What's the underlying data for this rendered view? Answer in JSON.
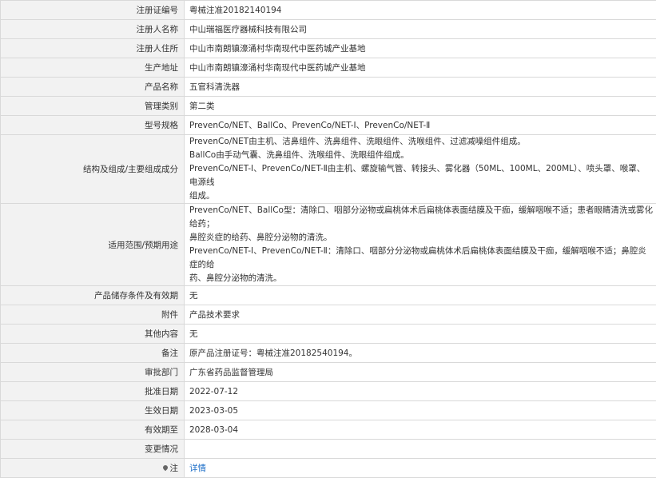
{
  "rows": [
    {
      "label": "注册证编号",
      "value": "粤械注准20182140194"
    },
    {
      "label": "注册人名称",
      "value": "中山瑞福医疗器械科技有限公司"
    },
    {
      "label": "注册人住所",
      "value": "中山市南朗镇濠涌村华南现代中医药城产业基地"
    },
    {
      "label": "生产地址",
      "value": "中山市南朗镇濠涌村华南现代中医药城产业基地"
    },
    {
      "label": "产品名称",
      "value": "五官科清洗器"
    },
    {
      "label": "管理类别",
      "value": "第二类"
    },
    {
      "label": "型号规格",
      "value": "PrevenCo/NET、BallCo、PrevenCo/NET-Ⅰ、PrevenCo/NET-Ⅱ"
    }
  ],
  "structure": {
    "label": "结构及组成/主要组成成分",
    "lines": [
      "PrevenCo/NET由主机、洁鼻组件、洗鼻组件、洗眼组件、洗喉组件、过滤减噪组件组成。",
      "BallCo由手动气囊、洗鼻组件、洗喉组件、洗眼组件组成。",
      "PrevenCo/NET-Ⅰ、PrevenCo/NET-Ⅱ由主机、螺旋输气管、转接头、雾化器（50ML、100ML、200ML）、喷头罩、喉罩、电源线",
      "组成。"
    ]
  },
  "usage": {
    "label": "适用范围/预期用途",
    "lines": [
      "PrevenCo/NET、BallCo型：清除口、咽部分泌物或扁桃体术后扁桃体表面结膜及干痂，缓解咽喉不适；患者眼睛清洗或雾化给药；",
      "鼻腔炎症的给药、鼻腔分泌物的清洗。",
      "PrevenCo/NET-Ⅰ、PrevenCo/NET-Ⅱ：清除口、咽部分分泌物或扁桃体术后扁桃体表面结膜及干痂，缓解咽喉不适；鼻腔炎症的给",
      "药、鼻腔分泌物的清洗。"
    ]
  },
  "rows2": [
    {
      "label": "产品储存条件及有效期",
      "value": "无"
    },
    {
      "label": "附件",
      "value": "产品技术要求"
    },
    {
      "label": "其他内容",
      "value": "无"
    },
    {
      "label": "备注",
      "value": "原产品注册证号：粤械注准20182540194。"
    },
    {
      "label": "审批部门",
      "value": "广东省药品监督管理局"
    },
    {
      "label": "批准日期",
      "value": "2022-07-12"
    },
    {
      "label": "生效日期",
      "value": "2023-03-05"
    },
    {
      "label": "有效期至",
      "value": "2028-03-04"
    },
    {
      "label": "变更情况",
      "value": ""
    }
  ],
  "note": {
    "label": "注",
    "link": "详情",
    "icon": "location-pin-icon"
  }
}
